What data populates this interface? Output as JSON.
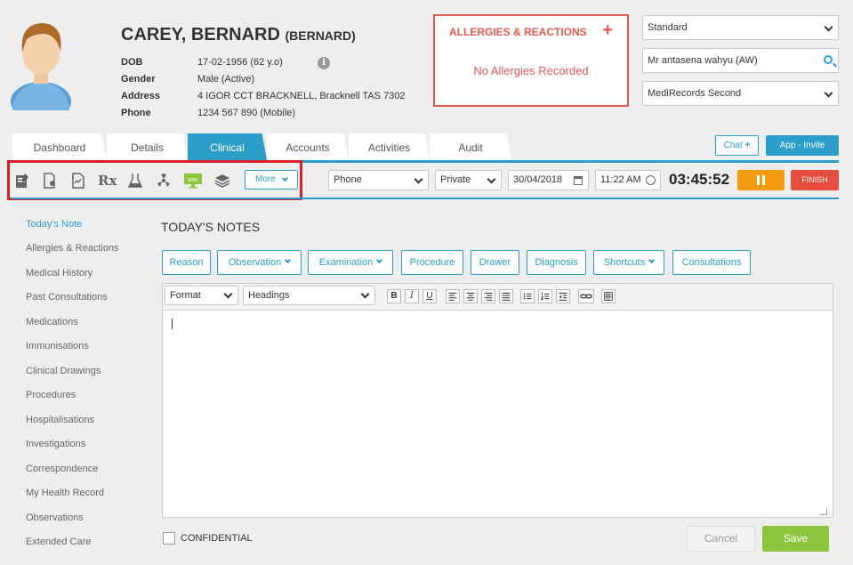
{
  "patient": {
    "name": "CAREY, BERNARD",
    "preferred": "(BERNARD)",
    "fields": [
      {
        "label": "DOB",
        "value": "17-02-1956 (62 y.o)"
      },
      {
        "label": "Gender",
        "value": "Male (Active)"
      },
      {
        "label": "Address",
        "value": "4 IGOR CCT BRACKNELL, Bracknell TAS 7302"
      },
      {
        "label": "Phone",
        "value": "1234 567 890 (Mobile)"
      }
    ]
  },
  "allergies": {
    "title": "ALLERGIES & REACTIONS",
    "add": "+",
    "none": "No Allergies Recorded"
  },
  "right_panel": {
    "billing": "Standard",
    "doctor": "Mr antasena wahyu (AW)",
    "location": "MediRecords Second"
  },
  "tabs": [
    "Dashboard",
    "Details",
    "Clinical",
    "Accounts",
    "Activities",
    "Audit"
  ],
  "active_tab": "Clinical",
  "chat": {
    "label": "Chat",
    "plus": "+"
  },
  "app_invite": "App - Invite",
  "toolbar": {
    "icons": [
      "notes-icon",
      "document-pin-icon",
      "report-icon",
      "prescription-icon",
      "lab-flask-icon",
      "radiology-icon",
      "mhr-monitor-icon",
      "stack-icon"
    ],
    "rx": "Rx",
    "mhr": "MHR",
    "more": "More"
  },
  "consult": {
    "type": "Phone",
    "billing": "Private",
    "date": "30/04/2018",
    "time": "11:22 AM",
    "timer": "03:45:52",
    "finish": "FINISH"
  },
  "sidebar": [
    "Today's Note",
    "Allergies & Reactions",
    "Medical History",
    "Past Consultations",
    "Medications",
    "Immunisations",
    "Clinical Drawings",
    "Procedures",
    "Hospitalisations",
    "Investigations",
    "Correspondence",
    "My Health Record",
    "Observations",
    "Extended Care"
  ],
  "content": {
    "title": "TODAY'S NOTES",
    "chips": [
      "Reason",
      "Observation",
      "Examination",
      "Procedure",
      "Drawer",
      "Diagnosis",
      "Shortcuts",
      "Consultations"
    ],
    "format": "Format",
    "headings": "Headings",
    "editor_buttons": [
      "B",
      "I",
      "U"
    ],
    "confidential": "CONFIDENTIAL",
    "cancel": "Cancel",
    "save": "Save"
  },
  "colors": {
    "accent": "#2b9fc9",
    "allergy": "#e05a52",
    "pause": "#f39c12",
    "finish": "#e74c3c",
    "save": "#8cc63f",
    "highlight": "#d92128"
  }
}
